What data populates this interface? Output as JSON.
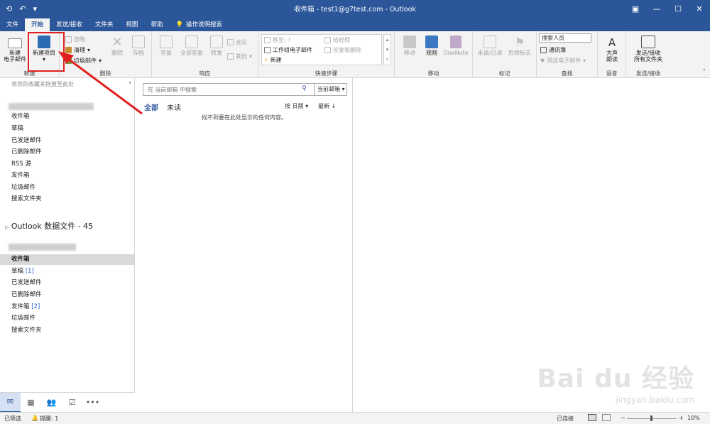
{
  "window": {
    "title": "收件箱 - test1@g7test.com - Outlook",
    "controls": [
      "restore-icon",
      "minimize-icon",
      "maximize-icon",
      "close-icon"
    ]
  },
  "quick_access": [
    "send-receive-icon",
    "undo-icon",
    "customize-icon"
  ],
  "tabs": [
    {
      "label": "文件"
    },
    {
      "label": "开始",
      "active": true
    },
    {
      "label": "发送/接收"
    },
    {
      "label": "文件夹"
    },
    {
      "label": "视图"
    },
    {
      "label": "帮助"
    },
    {
      "label": "操作说明搜索"
    }
  ],
  "ribbon": {
    "new_group": {
      "label": "新建",
      "new_email": "新建\n电子邮件",
      "new_email_l1": "新建",
      "new_email_l2": "电子邮件",
      "new_items": "新建项目",
      "new_items_arrow": "▾"
    },
    "delete_group": {
      "label": "删除",
      "ignore": "忽略",
      "cleanup": "清理",
      "junk": "垃圾邮件",
      "delete": "删除",
      "archive": "存档"
    },
    "respond_group": {
      "label": "响应",
      "reply": "答复",
      "reply_all": "全部答复",
      "forward": "转发",
      "meeting": "会议",
      "more": "其他"
    },
    "quicksteps_group": {
      "label": "快速步骤",
      "items": [
        "移至: ?",
        "给经理",
        "工作组电子邮件",
        "答复和删除",
        "新建"
      ]
    },
    "move_group": {
      "label": "移动",
      "move": "移动",
      "rules": "规则",
      "onenote": "OneNote"
    },
    "tags_group": {
      "label": "标记",
      "unread_read": "未读/已读",
      "followup": "后续标志"
    },
    "find_group": {
      "label": "查找",
      "search_people": "搜索人员",
      "address_book": "通讯簿",
      "filter_email": "筛选电子邮件"
    },
    "speech_group": {
      "label": "语音",
      "read_aloud_l1": "大声",
      "read_aloud_l2": "朗读"
    },
    "sendrecv_group": {
      "label": "发送/接收",
      "send_all_l1": "发送/接收",
      "send_all_l2": "所有文件夹"
    }
  },
  "nav": {
    "fav_hint": "将您的收藏夹拖放至此处",
    "collapse": "‹",
    "account1_folders": [
      {
        "name": "收件箱"
      },
      {
        "name": "草稿"
      },
      {
        "name": "已发送邮件"
      },
      {
        "name": "已删除邮件"
      },
      {
        "name": "RSS 源"
      },
      {
        "name": "发件箱"
      },
      {
        "name": "垃圾邮件"
      },
      {
        "name": "搜索文件夹"
      }
    ],
    "datafile": "Outlook 数据文件 - 45",
    "account2_folders": [
      {
        "name": "收件箱",
        "selected": true
      },
      {
        "name": "草稿",
        "count": "[1]"
      },
      {
        "name": "已发送邮件"
      },
      {
        "name": "已删除邮件"
      },
      {
        "name": "发件箱",
        "count": "[2]"
      },
      {
        "name": "垃圾邮件"
      },
      {
        "name": "搜索文件夹"
      }
    ],
    "bottom_icons": [
      "mail-icon",
      "calendar-icon",
      "people-icon",
      "tasks-icon",
      "more-icon"
    ]
  },
  "messages": {
    "search_placeholder": "在 当前邮箱 中搜索",
    "search_scope": "当前邮箱",
    "filter_all": "全部",
    "filter_unread": "未读",
    "sort_by": "按 日期",
    "sort_order": "最新",
    "empty_text": "找不到要在此处显示的任何内容。"
  },
  "statusbar": {
    "filtered": "已筛选",
    "reminder": "提醒: 1",
    "connected": "已连接",
    "zoom": "10%"
  },
  "watermark": {
    "brand": "Bai du 经验",
    "url": "jingyan.baidu.com"
  },
  "colors": {
    "accent": "#2b579a",
    "highlight": "#e02020",
    "selected_bg": "#d9d9d9"
  }
}
